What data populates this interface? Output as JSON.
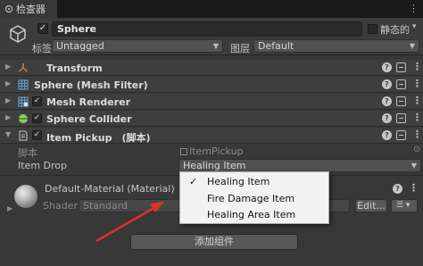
{
  "tab": {
    "title": "检查器",
    "menu_glyph": "⋮"
  },
  "header": {
    "object_name": "Sphere",
    "active_check": "✓",
    "static_label": "静态的",
    "tag_label": "标签",
    "tag_value": "Untagged",
    "layer_label": "图层",
    "layer_value": "Default"
  },
  "components": [
    {
      "name": "Transform",
      "icon": "transform-icon",
      "has_check": false
    },
    {
      "name": "Sphere (Mesh Filter)",
      "icon": "mesh-filter-icon",
      "has_check": false
    },
    {
      "name": "Mesh Renderer",
      "icon": "mesh-renderer-icon",
      "has_check": true
    },
    {
      "name": "Sphere Collider",
      "icon": "sphere-collider-icon",
      "has_check": true
    },
    {
      "name": "Item Pickup　(脚本)",
      "icon": "script-icon",
      "has_check": true
    }
  ],
  "item_pickup": {
    "script_label": "脚本",
    "script_value": "ItemPickup",
    "item_drop_label": "Item Drop",
    "item_drop_value": "Healing Item"
  },
  "material": {
    "name": "Default-Material (Material)",
    "shader_label": "Shader",
    "shader_value": "Standard",
    "edit_label": "Edit...",
    "list_glyph": "☰ ▾"
  },
  "add_component_label": "添加组件",
  "popup": {
    "selected_mark": "✓",
    "options": [
      "Healing Item",
      "Fire Damage Item",
      "Healing Area Item"
    ],
    "selected_index": 0
  },
  "colors": {
    "panel_bg": "#383838",
    "header_bg": "#3c3c3c",
    "popup_bg": "#f2f2f2",
    "arrow": "#e0302a"
  }
}
